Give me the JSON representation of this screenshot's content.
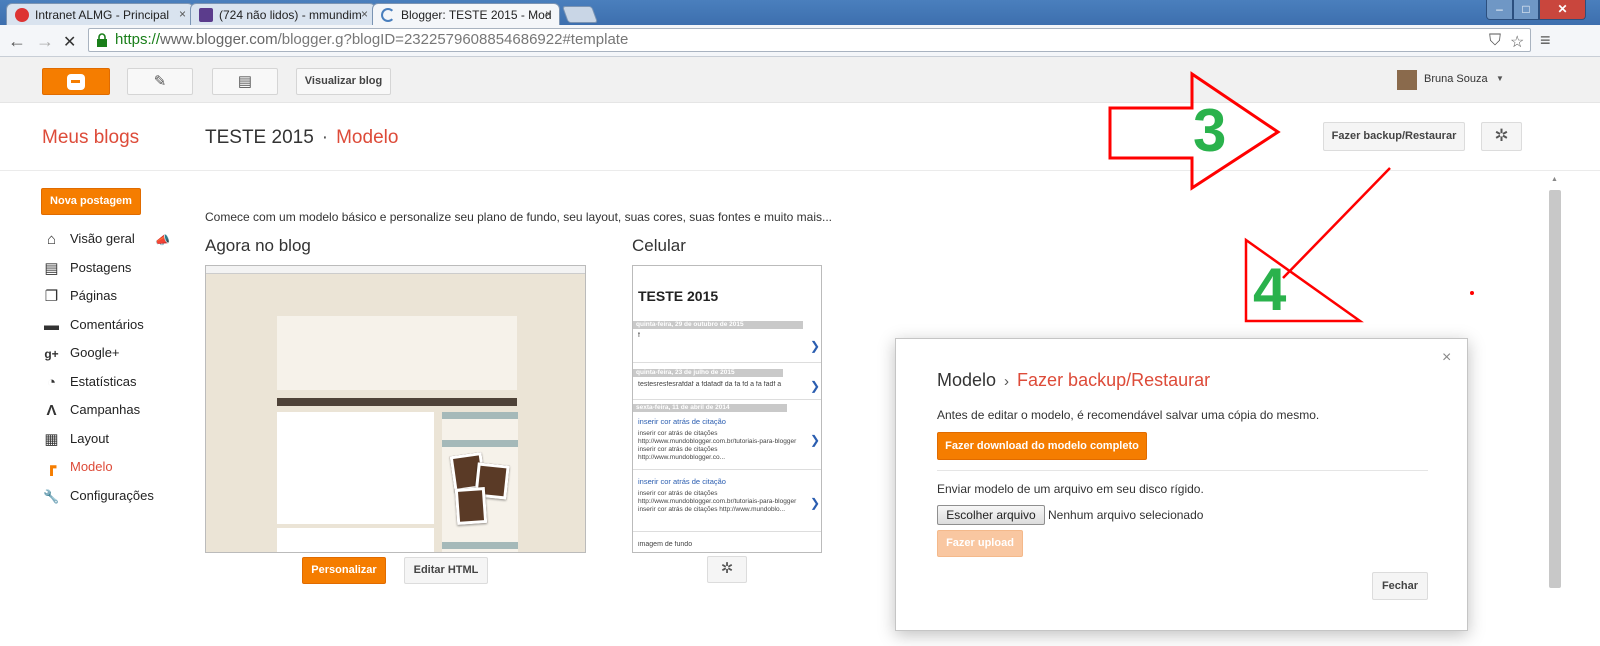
{
  "browser": {
    "tabs": [
      {
        "title": "Intranet ALMG - Principal",
        "close": "×"
      },
      {
        "title": "(724 não lidos) - mmundim",
        "close": "×"
      },
      {
        "title": "Blogger: TESTE 2015 - Mod",
        "close": "×"
      }
    ],
    "window_controls": {
      "minimize": "‒",
      "maximize": "□",
      "close": "✕"
    },
    "url_scheme": "https://",
    "url_host": "www.blogger.com",
    "url_path": "/blogger.g?blogID=2322579608854686922#template",
    "nav": {
      "back": "←",
      "forward": "→",
      "stop": "✕"
    },
    "toolbar_icons": {
      "shield": "⛉",
      "star": "☆",
      "menu": "≡"
    }
  },
  "appbar": {
    "view_blog_label": "Visualizar blog",
    "pencil_glyph": "✎",
    "pages_glyph": "▤",
    "user_name": "Bruna Souza",
    "user_caret": "▼"
  },
  "header": {
    "my_blogs": "Meus blogs",
    "blog_name": "TESTE 2015",
    "separator": "·",
    "section": "Modelo",
    "backup_button": "Fazer backup/Restaurar",
    "gear_glyph": "✲"
  },
  "sidebar": {
    "new_post": "Nova postagem",
    "items": [
      {
        "label": "Visão geral",
        "icon": "home-icon",
        "glyph": "⌂"
      },
      {
        "label": "Postagens",
        "icon": "posts-icon",
        "glyph": "▤"
      },
      {
        "label": "Páginas",
        "icon": "pages-icon",
        "glyph": "❐"
      },
      {
        "label": "Comentários",
        "icon": "comments-icon",
        "glyph": "▬"
      },
      {
        "label": "Google+",
        "icon": "googleplus-icon",
        "glyph": "g+"
      },
      {
        "label": "Estatísticas",
        "icon": "stats-icon",
        "glyph": "◔"
      },
      {
        "label": "Campanhas",
        "icon": "campaigns-icon",
        "glyph": "Λ"
      },
      {
        "label": "Layout",
        "icon": "layout-icon",
        "glyph": "▦"
      },
      {
        "label": "Modelo",
        "icon": "template-icon",
        "glyph": "┏"
      },
      {
        "label": "Configurações",
        "icon": "wrench-icon",
        "glyph": "🔧"
      }
    ],
    "megaphone_glyph": "📣"
  },
  "main": {
    "intro": "Comece com um modelo básico e personalize seu plano de fundo, seu layout, suas cores, suas fontes e muito mais...",
    "now_on_blog": "Agora no blog",
    "mobile": "Celular",
    "customize_button": "Personalizar",
    "edit_html_button": "Editar HTML",
    "mobile_gear_glyph": "✲",
    "mobile_preview": {
      "title": "TESTE 2015",
      "posts": [
        {
          "date": "quinta-feira, 29 de outubro de 2015",
          "snippet": "f"
        },
        {
          "date": "quinta-feira, 23 de julho de 2015",
          "snippet": "testesresfesrafdaf a fdafadf da fa fd a fa fadf a"
        },
        {
          "date": "sexta-feira, 11 de abril de 2014",
          "link": "inserir cor atrás de citação",
          "snippet": "inserir cor atrás de citações http://www.mundoblogger.com.br/tutoriais-para-blogger inserir cor atrás de citações http://www.mundoblogger.co..."
        },
        {
          "link": "inserir cor atrás de citação",
          "snippet": "inserir cor atrás de citações http://www.mundoblogger.com.br/tutoriais-para-blogger inserir cor atrás de citações http://www.mundoblo..."
        },
        {
          "snippet": "imagem de fundo"
        }
      ],
      "chevron": "❯"
    }
  },
  "dialog": {
    "title": "Modelo",
    "arrow": "›",
    "subtitle": "Fazer backup/Restaurar",
    "close_glyph": "×",
    "save_text": "Antes de editar o modelo, é recomendável salvar uma cópia do mesmo.",
    "download_button": "Fazer download do modelo completo",
    "upload_text": "Enviar modelo de um arquivo em seu disco rígido.",
    "choose_file": "Escolher arquivo",
    "no_file": "Nenhum arquivo selecionado",
    "upload_button": "Fazer upload",
    "close_button": "Fechar"
  },
  "annotations": {
    "step3": "3",
    "step4": "4",
    "color_arrow": "#ff0000",
    "color_number": "#2ab24c"
  },
  "colors": {
    "accent": "#f57d00",
    "link_red": "#dd4b39"
  }
}
